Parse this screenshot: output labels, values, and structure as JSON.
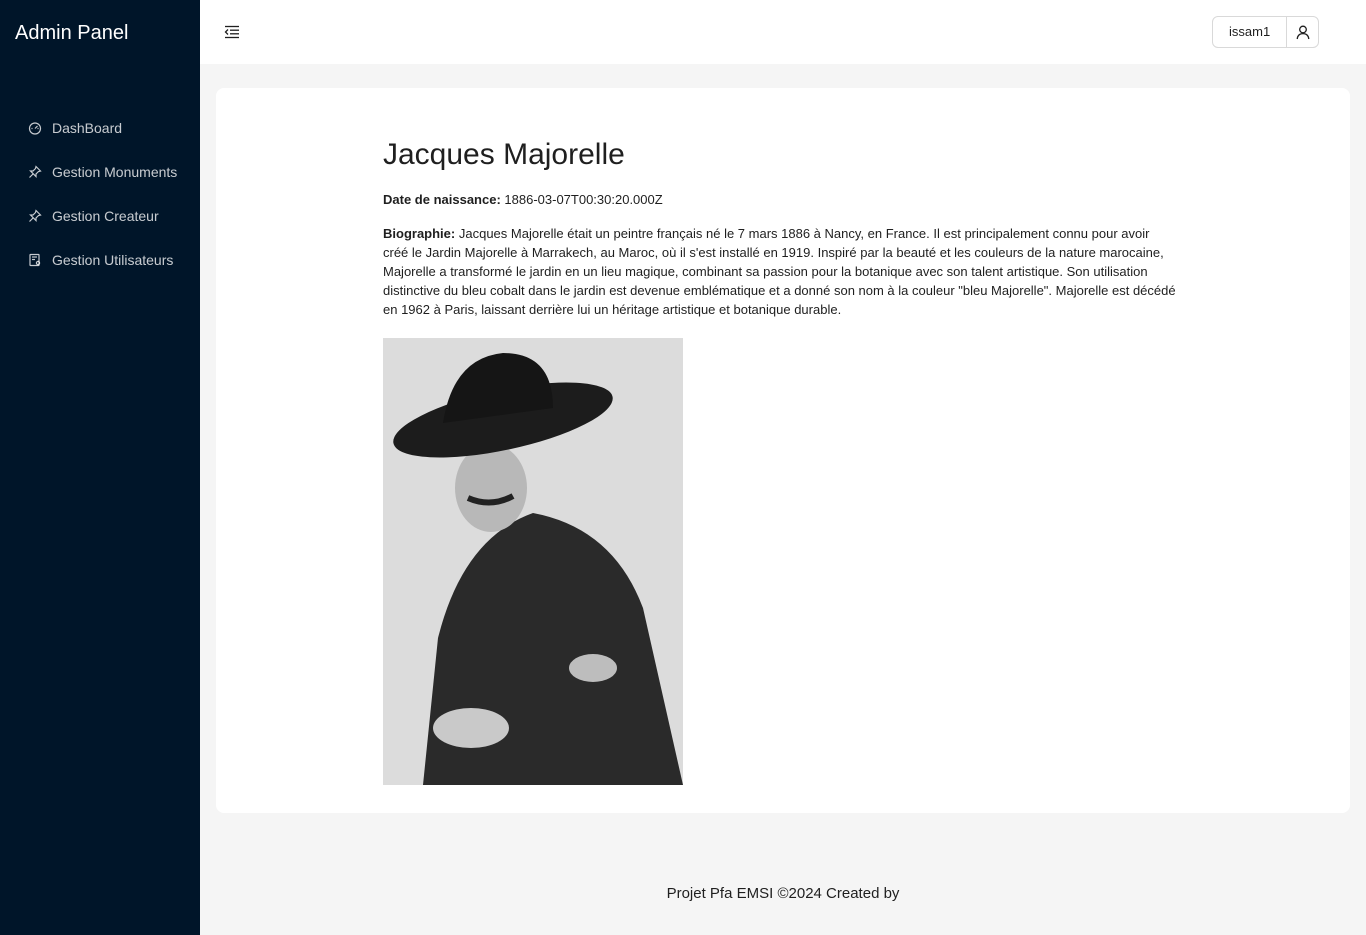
{
  "sidebar": {
    "title": "Admin Panel",
    "items": [
      {
        "label": "DashBoard",
        "icon": "dashboard-icon"
      },
      {
        "label": "Gestion Monuments",
        "icon": "pushpin-icon"
      },
      {
        "label": "Gestion Createur",
        "icon": "pushpin-icon"
      },
      {
        "label": "Gestion Utilisateurs",
        "icon": "user-list-icon"
      }
    ]
  },
  "header": {
    "menu_toggle_icon": "menu-fold-icon",
    "username": "issam1",
    "user_icon": "user-icon"
  },
  "creator": {
    "name": "Jacques Majorelle",
    "birth_label": "Date de naissance:",
    "birth_value": "1886-03-07T00:30:20.000Z",
    "bio_label": "Biographie:",
    "bio_text": "Jacques Majorelle était un peintre français né le 7 mars 1886 à Nancy, en France. Il est principalement connu pour avoir créé le Jardin Majorelle à Marrakech, au Maroc, où il s'est installé en 1919. Inspiré par la beauté et les couleurs de la nature marocaine, Majorelle a transformé le jardin en un lieu magique, combinant sa passion pour la botanique avec son talent artistique. Son utilisation distinctive du bleu cobalt dans le jardin est devenue emblématique et a donné son nom à la couleur \"bleu Majorelle\". Majorelle est décédé en 1962 à Paris, laissant derrière lui un héritage artistique et botanique durable."
  },
  "footer": {
    "text": "Projet Pfa EMSI ©2024 Created by"
  },
  "colors": {
    "sidebar_bg": "#001529",
    "page_bg": "#f5f5f5",
    "card_bg": "#ffffff"
  }
}
